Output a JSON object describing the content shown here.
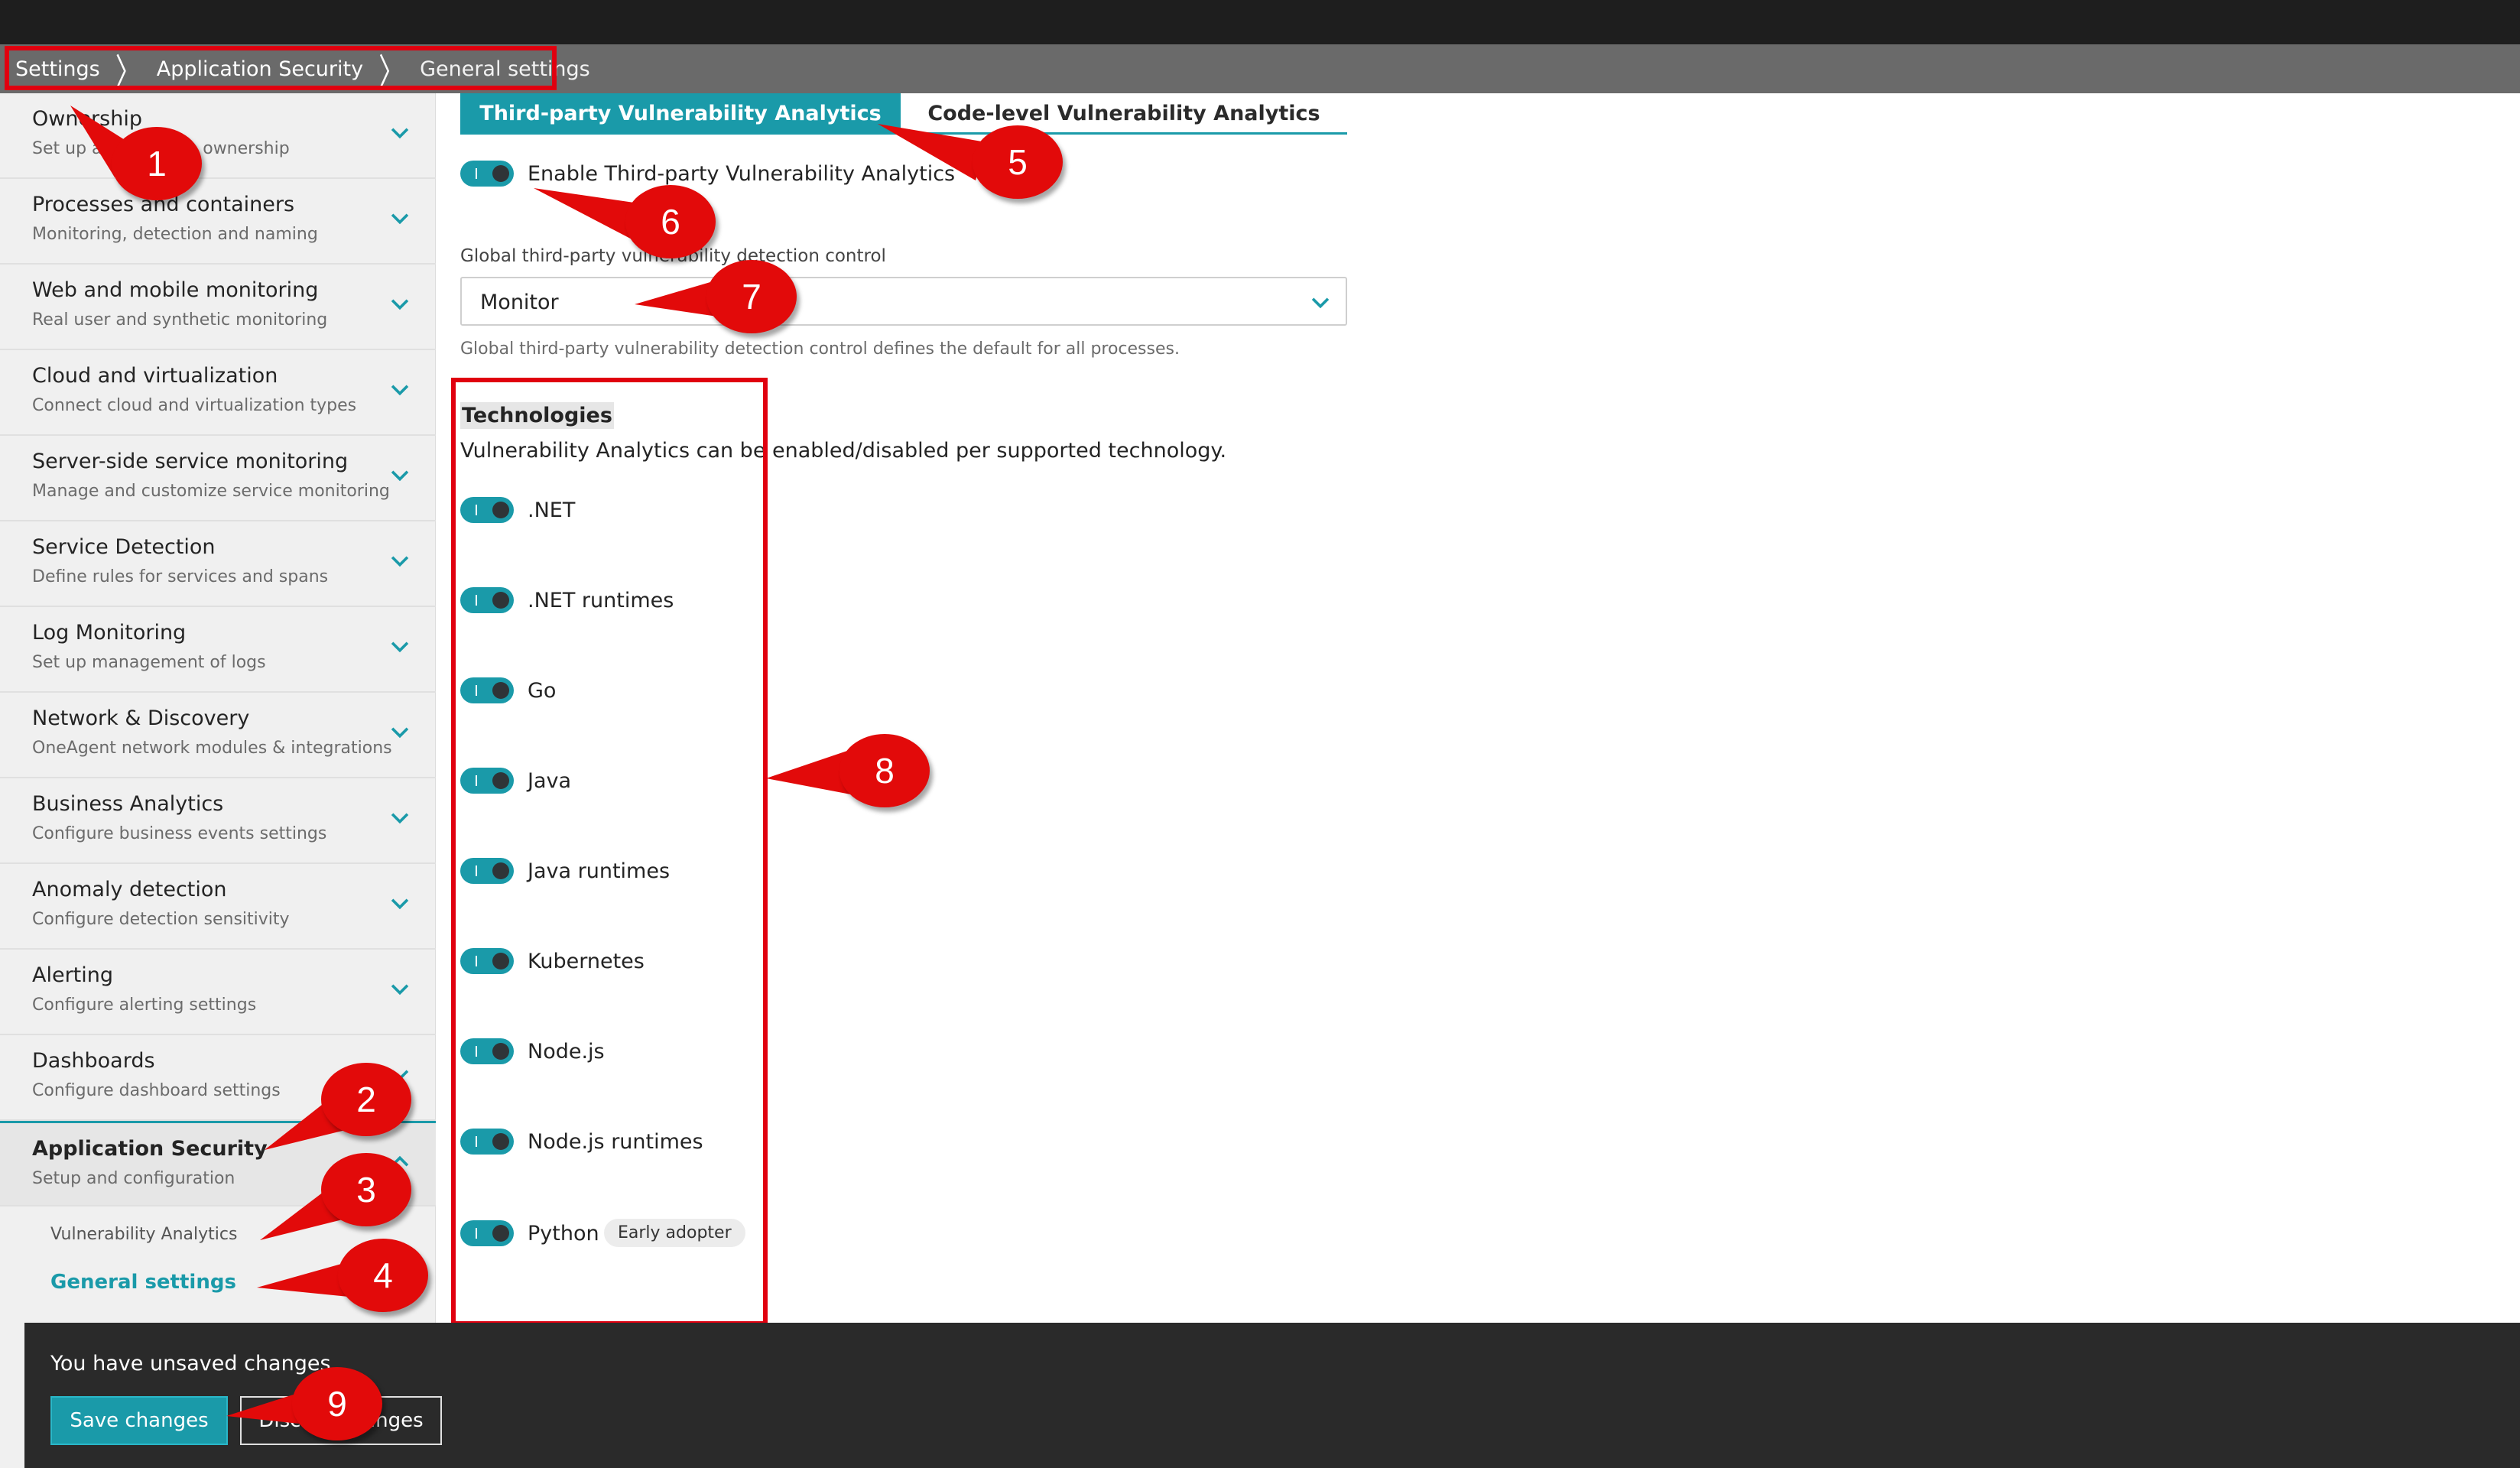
{
  "breadcrumb": {
    "items": [
      "Settings",
      "Application Security",
      "General settings"
    ]
  },
  "sidebar": {
    "items": [
      {
        "title": "Ownership",
        "subtitle": "Set up and manage ownership"
      },
      {
        "title": "Processes and containers",
        "subtitle": "Monitoring, detection and naming"
      },
      {
        "title": "Web and mobile monitoring",
        "subtitle": "Real user and synthetic monitoring"
      },
      {
        "title": "Cloud and virtualization",
        "subtitle": "Connect cloud and virtualization types"
      },
      {
        "title": "Server-side service monitoring",
        "subtitle": "Manage and customize service monitoring"
      },
      {
        "title": "Service Detection",
        "subtitle": "Define rules for services and spans"
      },
      {
        "title": "Log Monitoring",
        "subtitle": "Set up management of logs"
      },
      {
        "title": "Network & Discovery",
        "subtitle": "OneAgent network modules & integrations"
      },
      {
        "title": "Business Analytics",
        "subtitle": "Configure business events settings"
      },
      {
        "title": "Anomaly detection",
        "subtitle": "Configure detection sensitivity"
      },
      {
        "title": "Alerting",
        "subtitle": "Configure alerting settings"
      },
      {
        "title": "Dashboards",
        "subtitle": "Configure dashboard settings"
      },
      {
        "title": "Application Security",
        "subtitle": "Setup and configuration"
      }
    ],
    "sub_items": [
      "Vulnerability Analytics",
      "General settings"
    ]
  },
  "tabs": [
    "Third-party Vulnerability Analytics",
    "Code-level Vulnerability Analytics"
  ],
  "enable_toggle_label": "Enable Third-party Vulnerability Analytics",
  "detection_control": {
    "label": "Global third-party vulnerability detection control",
    "value": "Monitor",
    "helper": "Global third-party vulnerability detection control defines the default for all processes."
  },
  "technologies": {
    "heading": "Technologies",
    "description": "Vulnerability Analytics can be enabled/disabled per supported technology.",
    "items": [
      ".NET",
      ".NET runtimes",
      "Go",
      "Java",
      "Java runtimes",
      "Kubernetes",
      "Node.js",
      "Node.js runtimes",
      "Python"
    ],
    "python_badge": "Early adopter"
  },
  "unsaved": {
    "message": "You have unsaved changes",
    "save_label": "Save changes",
    "discard_label": "Discard changes"
  },
  "markers": [
    "1",
    "2",
    "3",
    "4",
    "5",
    "6",
    "7",
    "8",
    "9"
  ],
  "colors": {
    "accent": "#1a9aa9",
    "annotation": "#e0000f"
  }
}
